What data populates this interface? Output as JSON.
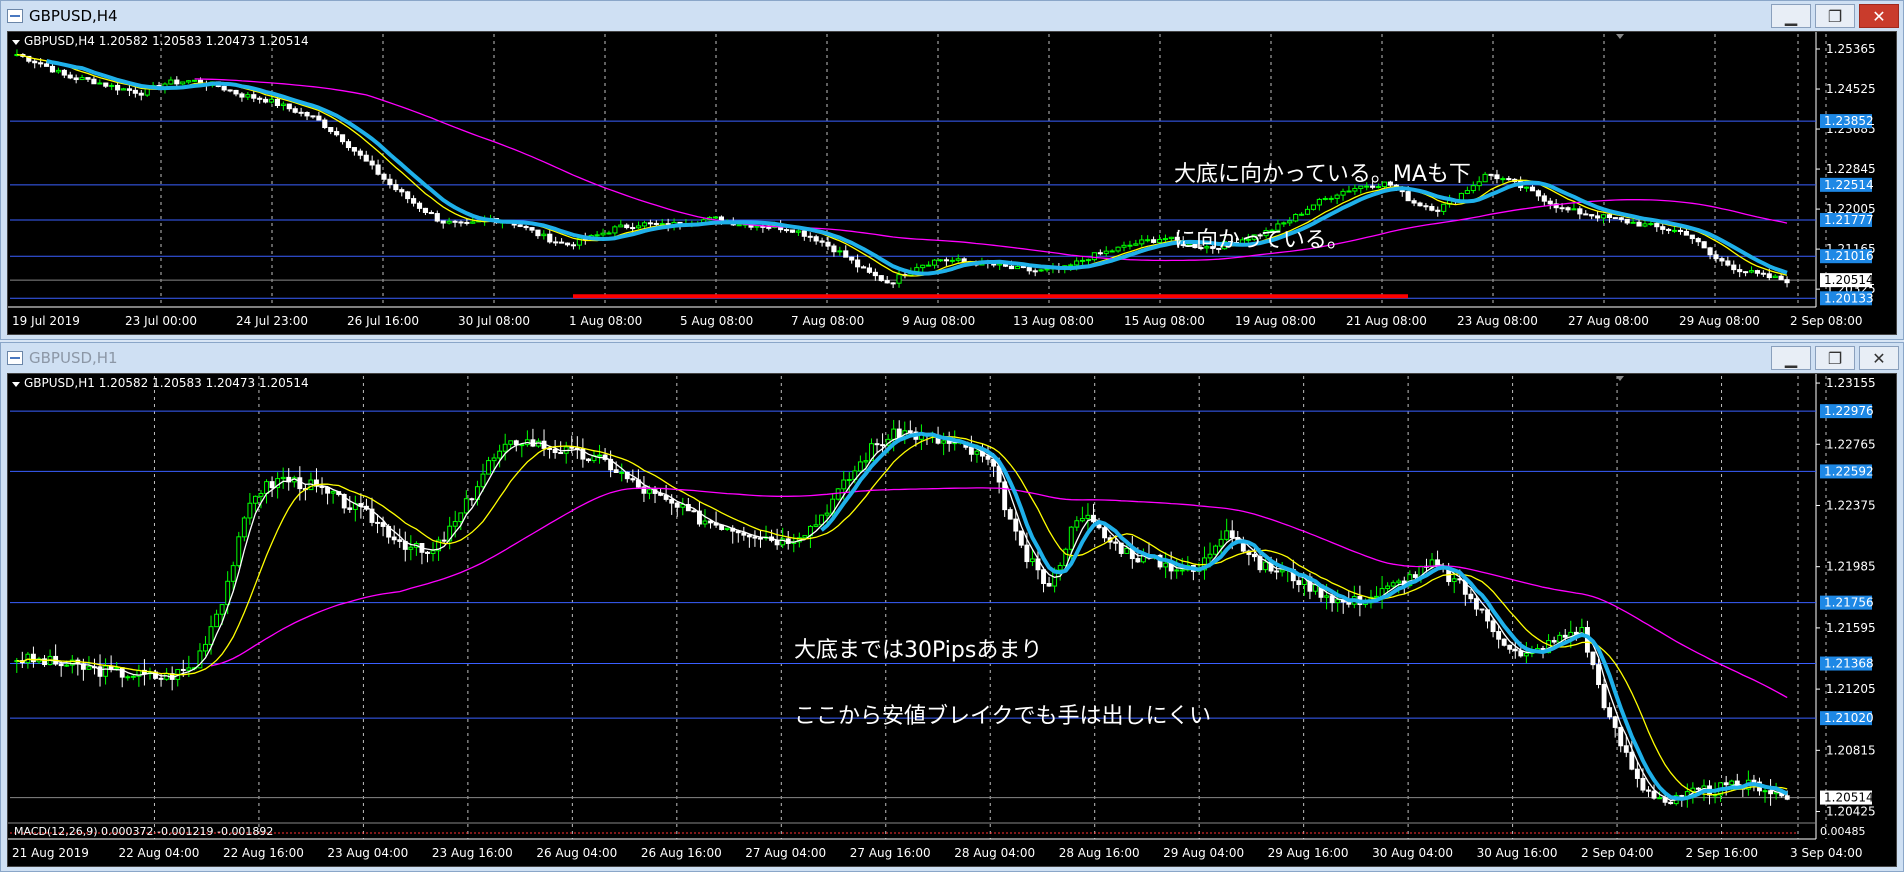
{
  "windows": [
    {
      "title": "GBPUSD,H4",
      "symbol_info": "GBPUSD,H4  1.20582 1.20583 1.20473 1.20514",
      "active": true,
      "annotation_lines": [
        "大底に向かっている。MAも下",
        "に向かっている。"
      ],
      "price_labels": [
        "1.25365",
        "1.24525",
        "1.23685",
        "1.22845",
        "1.22005",
        "1.21165",
        "1.20325"
      ],
      "hline_labels": [
        "1.23852",
        "1.22514",
        "1.21777",
        "1.21016",
        "1.20133"
      ],
      "current_price": "1.20514",
      "time_labels": [
        "19 Jul 2019",
        "23 Jul 00:00",
        "24 Jul 23:00",
        "26 Jul 16:00",
        "30 Jul 08:00",
        "1 Aug 08:00",
        "5 Aug 08:00",
        "7 Aug 08:00",
        "9 Aug 08:00",
        "13 Aug 08:00",
        "15 Aug 08:00",
        "19 Aug 08:00",
        "21 Aug 08:00",
        "23 Aug 08:00",
        "27 Aug 08:00",
        "29 Aug 08:00",
        "2 Sep 08:00"
      ],
      "price_range": [
        1.1995,
        1.2568
      ],
      "hlines": [
        1.23852,
        1.22514,
        1.21777,
        1.21016,
        1.20514,
        1.20133
      ],
      "support_line": 1.20133,
      "colors": {
        "ma_fast": "#ffff00",
        "ma_slow": "#ff00ff",
        "trend": "#1fb0ea",
        "support": "#ff0000",
        "hline": "#3a5fff",
        "candle_up": "#00ff00",
        "candle_down": "#ffffff"
      },
      "price_path": [
        1.2525,
        1.2505,
        1.2478,
        1.247,
        1.2455,
        1.2445,
        1.2465,
        1.247,
        1.246,
        1.244,
        1.243,
        1.241,
        1.239,
        1.235,
        1.23,
        1.225,
        1.221,
        1.2175,
        1.2165,
        1.218,
        1.217,
        1.2145,
        1.2125,
        1.214,
        1.216,
        1.217,
        1.2165,
        1.2175,
        1.218,
        1.217,
        1.2165,
        1.216,
        1.214,
        1.211,
        1.207,
        1.2045,
        1.208,
        1.2095,
        1.209,
        1.2085,
        1.2075,
        1.207,
        1.2075,
        1.21,
        1.2115,
        1.213,
        1.214,
        1.2125,
        1.212,
        1.2135,
        1.215,
        1.2175,
        1.221,
        1.2235,
        1.225,
        1.2255,
        1.2215,
        1.22,
        1.2235,
        1.2275,
        1.2255,
        1.223,
        1.22,
        1.219,
        1.218,
        1.217,
        1.216,
        1.215,
        1.21,
        1.2075,
        1.206,
        1.2051
      ]
    },
    {
      "title": "GBPUSD,H1",
      "symbol_info": "GBPUSD,H1  1.20582 1.20583 1.20473 1.20514",
      "active": false,
      "annotation_lines": [
        "大底までは30Pipsあまり",
        "ここから安値ブレイクでも手は出しにくい"
      ],
      "price_labels": [
        "1.23155",
        "1.22765",
        "1.22375",
        "1.21985",
        "1.21595",
        "1.21205",
        "1.20815",
        "1.20425"
      ],
      "hline_labels": [
        "1.22976",
        "1.22592",
        "1.21756",
        "1.21368",
        "1.21020"
      ],
      "current_price": "1.20514",
      "time_labels": [
        "21 Aug 2019",
        "22 Aug 04:00",
        "22 Aug 16:00",
        "23 Aug 04:00",
        "23 Aug 16:00",
        "26 Aug 04:00",
        "26 Aug 16:00",
        "27 Aug 04:00",
        "27 Aug 16:00",
        "28 Aug 04:00",
        "28 Aug 16:00",
        "29 Aug 04:00",
        "29 Aug 16:00",
        "30 Aug 04:00",
        "30 Aug 16:00",
        "2 Sep 04:00",
        "2 Sep 16:00",
        "3 Sep 04:00"
      ],
      "indicator_text": "MACD(12,26,9) 0.000372 -0.001219 -0.001892",
      "indicator_right": "0.00485",
      "price_range": [
        1.2025,
        1.232
      ],
      "hlines": [
        1.22976,
        1.22592,
        1.21756,
        1.21368,
        1.2102,
        1.20514
      ],
      "colors": {
        "ma_fast": "#ffffff",
        "ma_mid": "#ffff00",
        "ma_slow": "#ff00ff",
        "trend": "#1fb0ea",
        "hline": "#3a5fff",
        "candle_up": "#00ff00",
        "candle_down": "#ffffff"
      },
      "price_path": [
        1.214,
        1.2138,
        1.2135,
        1.2132,
        1.213,
        1.2128,
        1.2135,
        1.218,
        1.2245,
        1.2255,
        1.225,
        1.224,
        1.223,
        1.2215,
        1.2205,
        1.223,
        1.2265,
        1.228,
        1.2275,
        1.227,
        1.2265,
        1.225,
        1.224,
        1.223,
        1.2225,
        1.222,
        1.2215,
        1.2225,
        1.225,
        1.2275,
        1.2285,
        1.228,
        1.2275,
        1.2265,
        1.221,
        1.2185,
        1.2235,
        1.2215,
        1.2205,
        1.22,
        1.2195,
        1.2225,
        1.22,
        1.2195,
        1.2185,
        1.2175,
        1.218,
        1.219,
        1.22,
        1.2185,
        1.216,
        1.214,
        1.215,
        1.216,
        1.21,
        1.206,
        1.2048,
        1.2055,
        1.2058,
        1.206,
        1.2051
      ]
    }
  ]
}
